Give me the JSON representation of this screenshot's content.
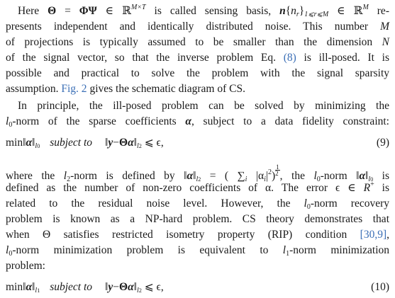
{
  "paragraph1": {
    "l1_a": "Here ",
    "theta": "Θ",
    "l1_b": " = ",
    "phipsi": "ΦΨ",
    "l1_c": " ∈ ℝ",
    "l1_sup1": "M×T",
    "l1_d": " is called sensing basis, ",
    "n_bold": "n",
    "l1_e": "{",
    "n_r": "n",
    "r_sub": "r",
    "l1_f": "}",
    "range_sub": "1⩽r⩽M",
    "l1_g": " ∈ ℝ",
    "l1_sup2": "M",
    "l1_h": " re-",
    "l2": "presents independent and identically distributed noise. This number ",
    "l2_M": "M",
    "l3": "of projections is typically assumed to be smaller than the dimension ",
    "l3_N": "N",
    "l4_a": "of the signal vector, so that the inverse problem Eq. ",
    "l4_link": "(8)",
    "l4_b": " is ill-posed. It is",
    "l5": "possible and practical to solve the problem with the signal sparsity",
    "l6_a": "assumption. ",
    "l6_link": "Fig. 2",
    "l6_b": " gives the schematic diagram of CS."
  },
  "paragraph2": {
    "l1": "In principle, the ill-posed problem can be solved by minimizing the",
    "l2_l": "l",
    "l2_sub": "0",
    "l2_a": "-norm of the sparse coefficients ",
    "l2_alpha": "α",
    "l2_b": ", subject to a data fidelity constraint:"
  },
  "equation9": {
    "min": "min‖",
    "alpha": "α",
    "norm_close": "‖",
    "sub_l": "l",
    "sub_0": "0",
    "subject": "subject to",
    "norm2_open": "‖",
    "y": "y",
    "minus": "−",
    "theta": "Θ",
    "alpha2": "α",
    "norm2_close": "‖",
    "sub2_l": "l",
    "sub2_2": "2",
    "rest": " ⩽ ϵ,",
    "number": "(9)"
  },
  "paragraph3": {
    "l1_a": "where the ",
    "l1_l": "l",
    "l1_sub2": "2",
    "l1_b": "-norm is defined by ‖",
    "l1_alpha": "α",
    "l1_c": "‖",
    "l1_subl": "l",
    "l1_sub2b": "2",
    "l1_d": " = ( ∑",
    "l1_i": "i",
    "l1_e": " |α",
    "l1_i2": "i",
    "l1_f": "|",
    "l1_sq": "2",
    "l1_g": ")",
    "frac_n": "1",
    "frac_d": "2",
    "l1_h": ", the ",
    "l1_l0": "l",
    "l1_sub0": "0",
    "l1_i3": "-norm ‖",
    "l1_alpha2": "α",
    "l1_j": "‖",
    "l1_subl0": "l",
    "l1_sub00": "0",
    "l1_k": " is",
    "l2_a": "defined as the number of non-zero coefficients of α. The error ϵ ∈ ",
    "l2_R": "R",
    "l2_plus": "+",
    "l2_b": " is",
    "l3_a": "related to the residual noise level. However, the ",
    "l3_l": "l",
    "l3_sub": "0",
    "l3_b": "-norm recovery",
    "l4": "problem is known as a NP-hard problem. CS theory demonstrates that",
    "l5_a": "when Θ satisfies restricted isometry property (RIP) condition ",
    "l5_link": "[30,9]",
    "l5_b": ",",
    "l6_l": "l",
    "l6_sub0": "0",
    "l6_a": "-norm minimization problem is equivalent to ",
    "l6_l1": "l",
    "l6_sub1": "1",
    "l6_b": "-norm minimization",
    "l7": "problem:"
  },
  "equation10": {
    "min": "min‖",
    "alpha": "α",
    "norm_close": "‖",
    "sub_l": "l",
    "sub_1": "1",
    "subject": "subject to",
    "norm2_open": "‖",
    "y": "y",
    "minus": "−",
    "theta": "Θ",
    "alpha2": "α",
    "norm2_close": "‖",
    "sub2_l": "l",
    "sub2_2": "2",
    "rest": " ⩽ ϵ,",
    "number": "(10)"
  },
  "colors": {
    "text": "#1a1a1a",
    "link": "#3b6fb6"
  }
}
